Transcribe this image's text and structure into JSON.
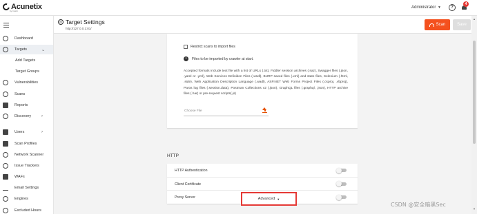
{
  "app": {
    "logo_text": "Acunetix",
    "logo_sub": "by Invicti"
  },
  "topbar": {
    "user": "Administrator",
    "help_glyph": "?",
    "notification_count": "4"
  },
  "page": {
    "title": "Target Settings",
    "url": "http://127.0.0.1:81/",
    "scan_label": "Scan",
    "save_label": "Save"
  },
  "sidebar": {
    "items": [
      {
        "label": "Dashboard",
        "icon": "dashboard-icon"
      },
      {
        "label": "Targets",
        "icon": "target-icon",
        "active": true
      },
      {
        "label": "Add Targets"
      },
      {
        "label": "Target Groups"
      },
      {
        "label": "Vulnerabilities",
        "icon": "bug-icon"
      },
      {
        "label": "Scans",
        "icon": "radar-icon"
      },
      {
        "label": "Reports",
        "icon": "report-icon"
      },
      {
        "label": "Discovery",
        "icon": "compass-icon"
      },
      {
        "label": "Users",
        "icon": "users-icon"
      },
      {
        "label": "Scan Profiles",
        "icon": "shield-icon"
      },
      {
        "label": "Network Scanner",
        "icon": "network-icon"
      },
      {
        "label": "Issue Trackers",
        "icon": "tracker-icon"
      },
      {
        "label": "WAFs",
        "icon": "waf-icon"
      },
      {
        "label": "Email Settings",
        "icon": "bell-icon"
      },
      {
        "label": "Engines",
        "icon": "engine-icon"
      },
      {
        "label": "Excluded Hours",
        "icon": "clock-icon"
      }
    ]
  },
  "import": {
    "restrict_label": "Restrict scans to import files",
    "info_text": "Files to be imported by crawler at start.",
    "accepted_text": "Accepted formats include text file with a list of URLs (.txt), Fiddler session archives (.saz), Swagger files (.json, .yaml or .yml), Web Services Definition Files (.wsdl), BURP saved files (.xml) and state files, Selenium (.html, .side), Web Application Description Language (.wadl), ASP.NET Web Forms Project Files (.csproj, .vbproj), Paros log files (.session.data), Postman Collections v2 (.json), GraphQL files (.graphql, .json), HTTP archive files (.har) or pre-request scripts(.js)",
    "choose_file_placeholder": "Choose File"
  },
  "http": {
    "title": "HTTP",
    "rows": [
      {
        "label": "HTTP Authentication",
        "enabled": false
      },
      {
        "label": "Client Certificate",
        "enabled": false
      },
      {
        "label": "Proxy Server",
        "enabled": false
      }
    ]
  },
  "advanced_label": "Advanced",
  "watermark": "CSDN @安全暗黑Sec",
  "colors": {
    "accent": "#f4511e",
    "highlight_border": "#e53935"
  }
}
